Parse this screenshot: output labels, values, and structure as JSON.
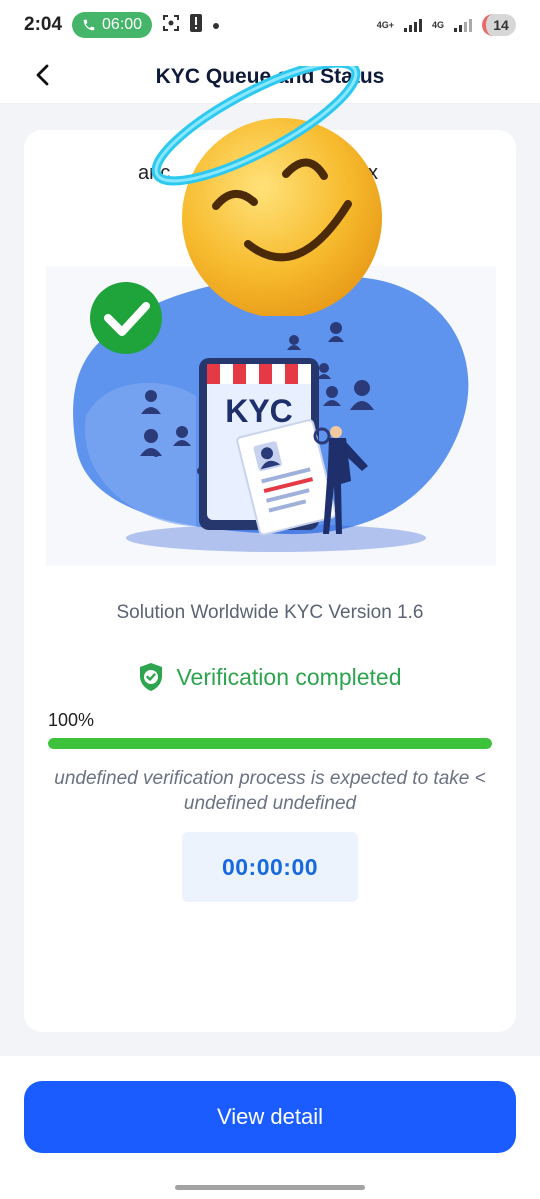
{
  "status_bar": {
    "time": "2:04",
    "call_duration": "06:00",
    "network_1": "4G+",
    "network_2": "4G",
    "battery": "14",
    "icons": [
      "phone-icon",
      "screenshot-icon",
      "alert-icon",
      "dot-icon",
      "signal-icon",
      "battery-icon"
    ]
  },
  "header": {
    "title": "KYC Queue and Status",
    "back_icon": "chevron-left-icon"
  },
  "card": {
    "partial_heading_left": "anc",
    "partial_heading_right": "x",
    "illustration_label": "KYC",
    "version_text": "Solution Worldwide KYC Version 1.6",
    "verification_status": "Verification completed",
    "progress_label": "100%",
    "progress_fraction": 1.0,
    "expected_note": "undefined verification process is expected to take < undefined undefined",
    "timer": "00:00:00"
  },
  "footer": {
    "cta_label": "View detail"
  },
  "colors": {
    "primary": "#1a5cff",
    "success": "#2ea44f",
    "progress": "#3cc23b",
    "timer_text": "#1769e0",
    "title": "#0f1a3a"
  }
}
